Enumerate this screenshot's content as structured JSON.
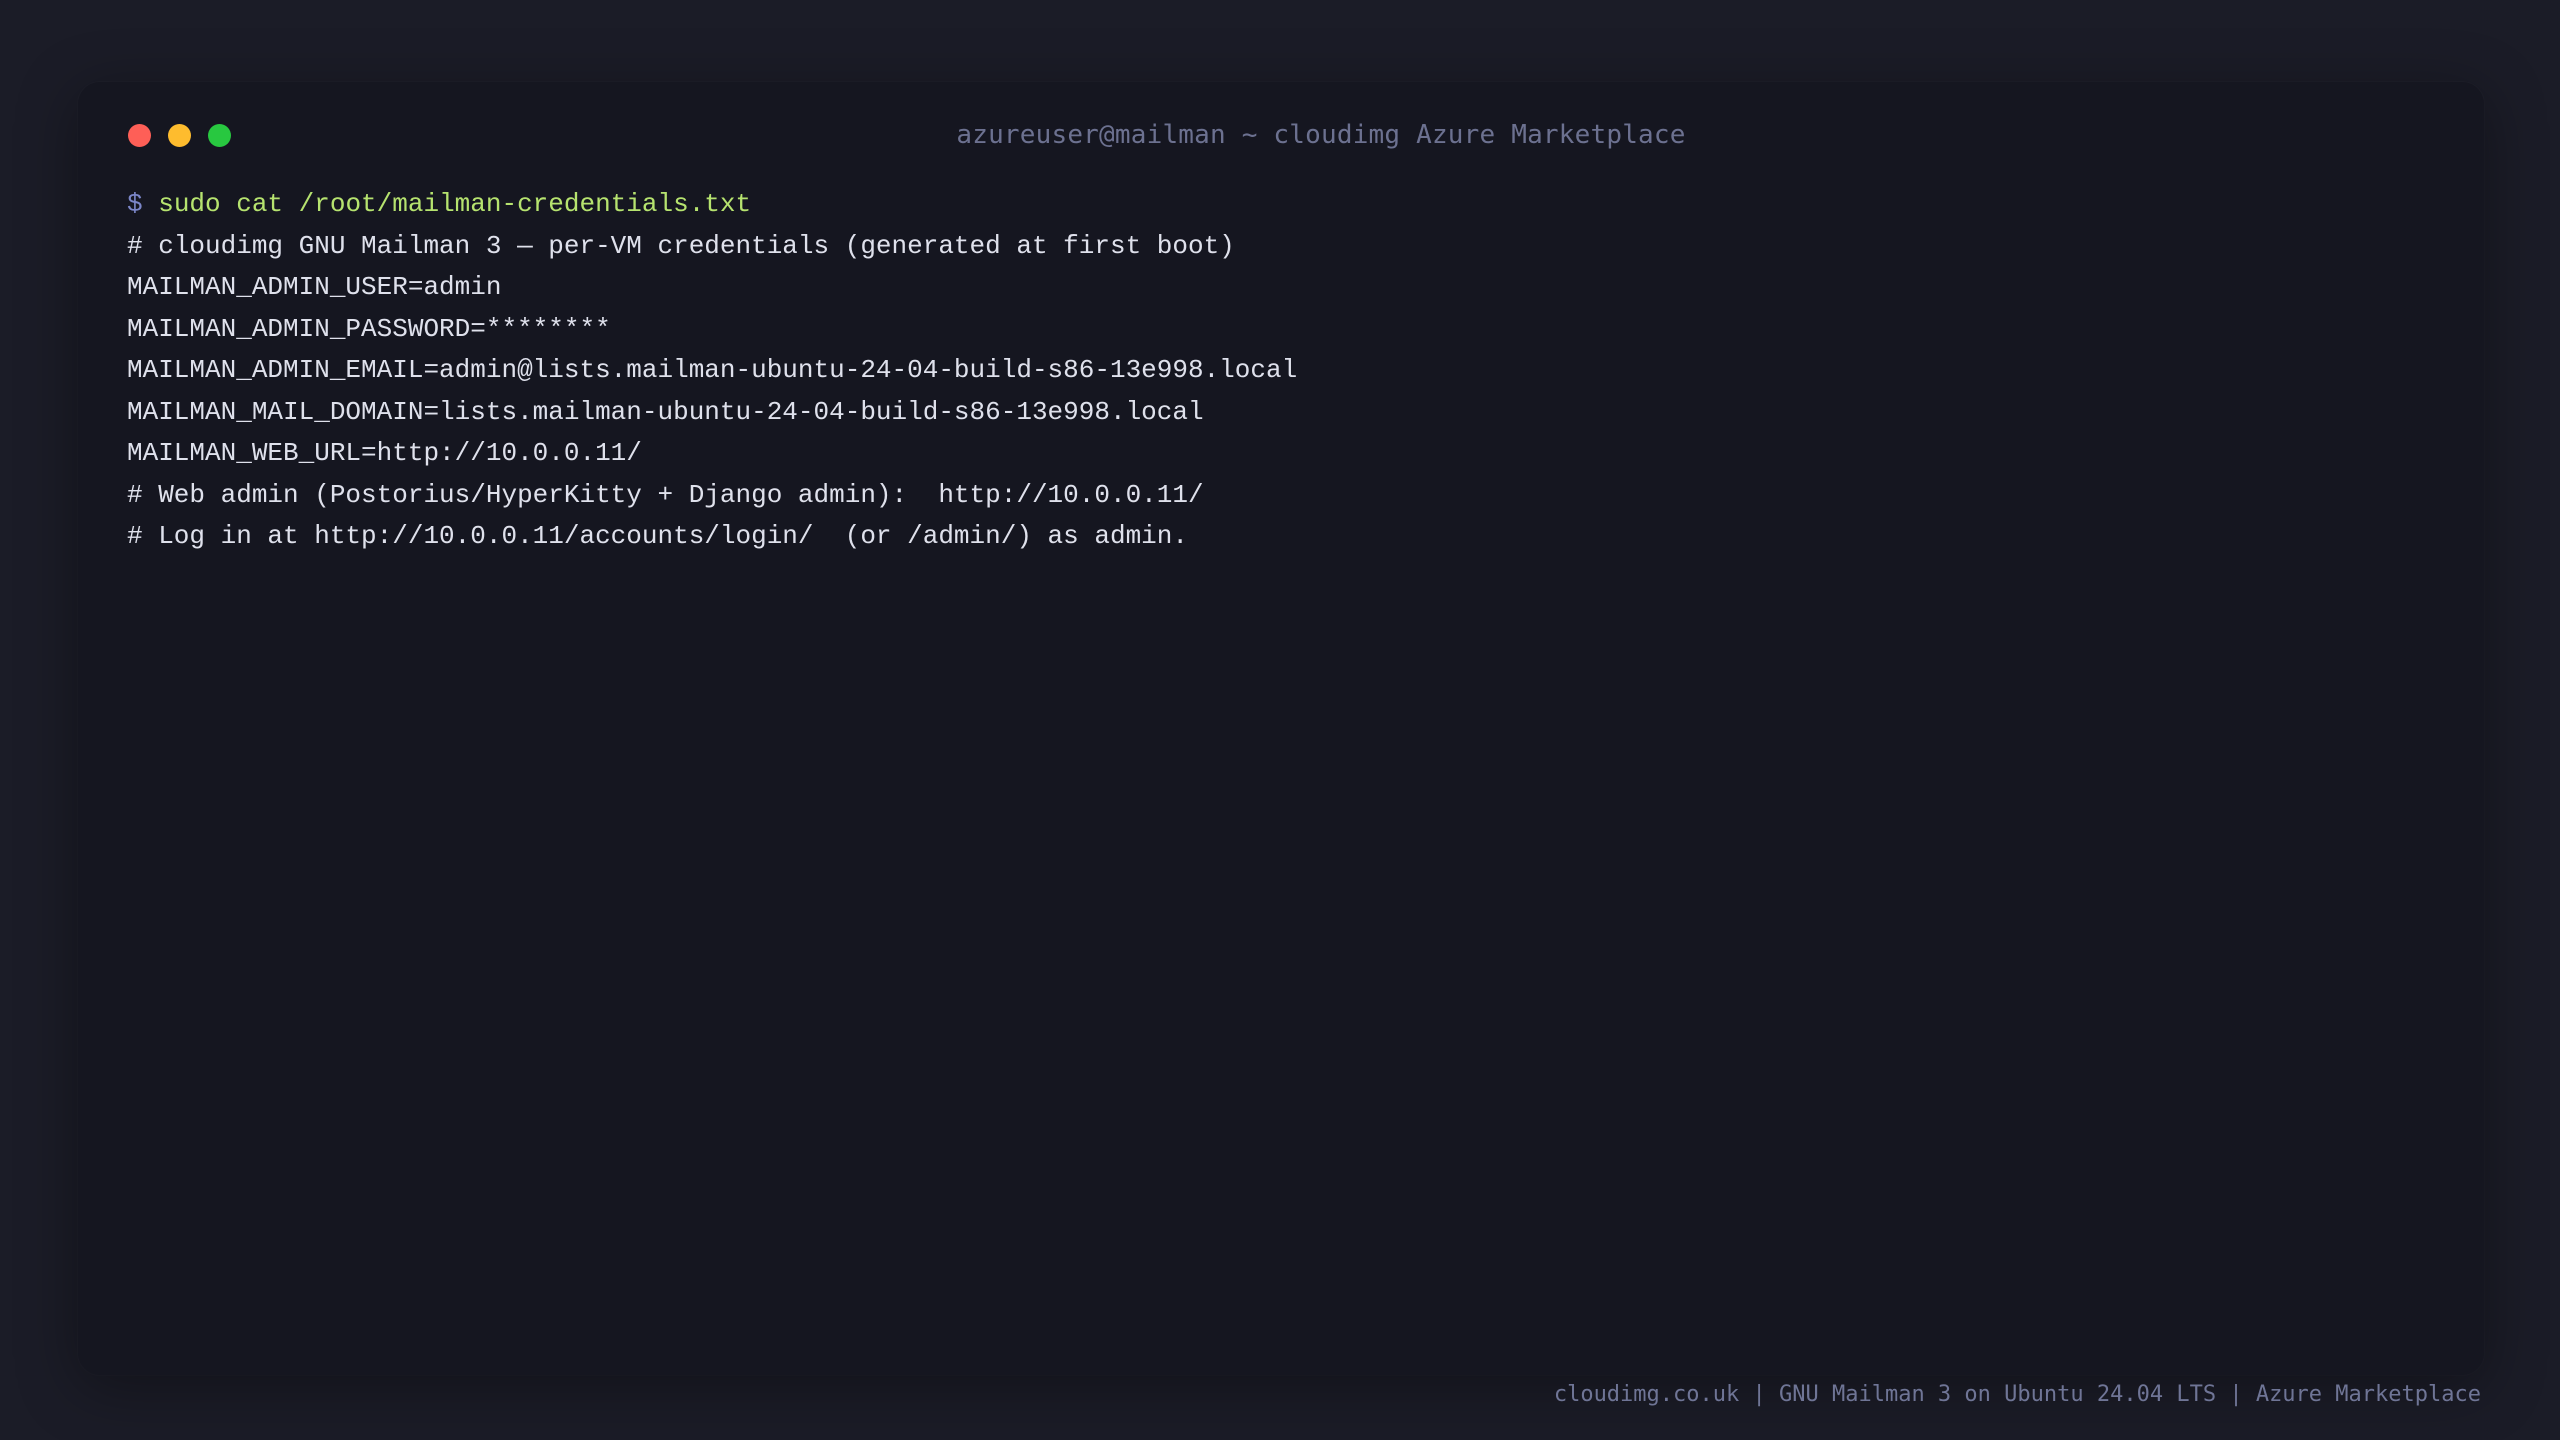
{
  "window": {
    "title": "azureuser@mailman ~ cloudimg Azure Marketplace",
    "controls": {
      "close_color": "#fe5f57",
      "minimize_color": "#febc2e",
      "maximize_color": "#28c840"
    }
  },
  "terminal": {
    "prompt": "$",
    "command": "sudo cat /root/mailman-credentials.txt",
    "output": [
      "# cloudimg GNU Mailman 3 — per-VM credentials (generated at first boot)",
      "MAILMAN_ADMIN_USER=admin",
      "MAILMAN_ADMIN_PASSWORD=********",
      "MAILMAN_ADMIN_EMAIL=admin@lists.mailman-ubuntu-24-04-build-s86-13e998.local",
      "MAILMAN_MAIL_DOMAIN=lists.mailman-ubuntu-24-04-build-s86-13e998.local",
      "MAILMAN_WEB_URL=http://10.0.0.11/",
      "# Web admin (Postorius/HyperKitty + Django admin):  http://10.0.0.11/",
      "# Log in at http://10.0.0.11/accounts/login/  (or /admin/) as admin."
    ]
  },
  "footer": {
    "text": "cloudimg.co.uk | GNU Mailman 3 on Ubuntu 24.04 LTS | Azure Marketplace"
  },
  "colors": {
    "background": "#1b1c27",
    "window": "#151620",
    "prompt": "#7b86c8",
    "command": "#b6e36f",
    "text": "#dfe1ec",
    "muted": "#6c7190"
  }
}
